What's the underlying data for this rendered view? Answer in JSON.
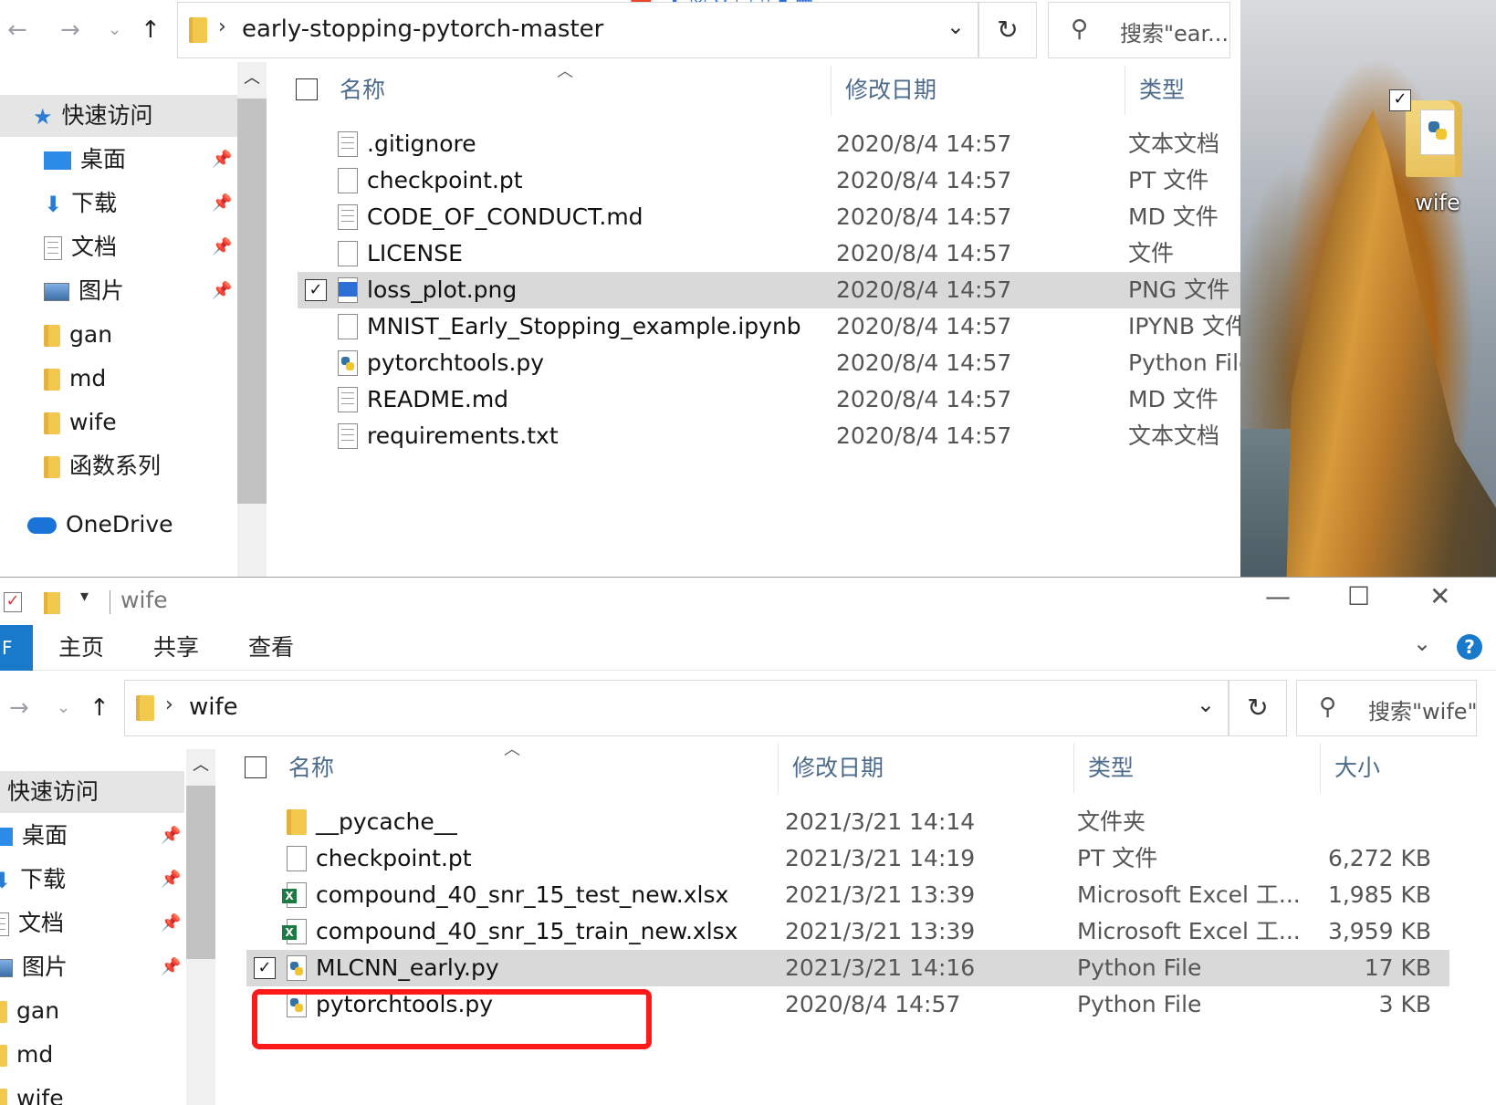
{
  "desktop": {
    "icon_label": "wife"
  },
  "window1": {
    "address_path": "early-stopping-pytorch-master",
    "search_placeholder": "搜索\"ear...",
    "nav": {
      "quick_access": "快速访问",
      "items": [
        "桌面",
        "下载",
        "文档",
        "图片",
        "gan",
        "md",
        "wife",
        "函数系列"
      ],
      "onedrive": "OneDrive"
    },
    "columns": {
      "name": "名称",
      "date": "修改日期",
      "type": "类型"
    },
    "files": [
      {
        "name": ".gitignore",
        "date": "2020/8/4 14:57",
        "type": "文本文档",
        "icon": "text-file-icon"
      },
      {
        "name": "checkpoint.pt",
        "date": "2020/8/4 14:57",
        "type": "PT 文件",
        "icon": "blank-file-icon"
      },
      {
        "name": "CODE_OF_CONDUCT.md",
        "date": "2020/8/4 14:57",
        "type": "MD 文件",
        "icon": "text-file-icon"
      },
      {
        "name": "LICENSE",
        "date": "2020/8/4 14:57",
        "type": "文件",
        "icon": "blank-file-icon"
      },
      {
        "name": "loss_plot.png",
        "date": "2020/8/4 14:57",
        "type": "PNG 文件",
        "icon": "image-file-icon",
        "selected": true
      },
      {
        "name": "MNIST_Early_Stopping_example.ipynb",
        "date": "2020/8/4 14:57",
        "type": "IPYNB 文件",
        "icon": "blank-file-icon"
      },
      {
        "name": "pytorchtools.py",
        "date": "2020/8/4 14:57",
        "type": "Python File",
        "icon": "python-file-icon"
      },
      {
        "name": "README.md",
        "date": "2020/8/4 14:57",
        "type": "MD 文件",
        "icon": "text-file-icon"
      },
      {
        "name": "requirements.txt",
        "date": "2020/8/4 14:57",
        "type": "文本文档",
        "icon": "text-file-icon"
      }
    ]
  },
  "window2": {
    "title": "wife",
    "ribbon_tabs": [
      "主页",
      "共享",
      "查看"
    ],
    "ribbon_file_tab": "F",
    "address_path": "wife",
    "search_placeholder": "搜索\"wife\"",
    "nav": {
      "quick_access": "快速访问",
      "items": [
        "桌面",
        "下载",
        "文档",
        "图片",
        "gan",
        "md",
        "wife"
      ]
    },
    "columns": {
      "name": "名称",
      "date": "修改日期",
      "type": "类型",
      "size": "大小"
    },
    "files": [
      {
        "name": "__pycache__",
        "date": "2021/3/21 14:14",
        "type": "文件夹",
        "size": "",
        "icon": "folder-icon"
      },
      {
        "name": "checkpoint.pt",
        "date": "2021/3/21 14:19",
        "type": "PT 文件",
        "size": "6,272 KB",
        "icon": "blank-file-icon"
      },
      {
        "name": "compound_40_snr_15_test_new.xlsx",
        "date": "2021/3/21 13:39",
        "type": "Microsoft Excel 工...",
        "size": "1,985 KB",
        "icon": "excel-file-icon"
      },
      {
        "name": "compound_40_snr_15_train_new.xlsx",
        "date": "2021/3/21 13:39",
        "type": "Microsoft Excel 工...",
        "size": "3,959 KB",
        "icon": "excel-file-icon"
      },
      {
        "name": "MLCNN_early.py",
        "date": "2021/3/21 14:16",
        "type": "Python File",
        "size": "17 KB",
        "icon": "python-file-icon",
        "selected": true
      },
      {
        "name": "pytorchtools.py",
        "date": "2020/8/4 14:57",
        "type": "Python File",
        "size": "3 KB",
        "icon": "python-file-icon"
      }
    ]
  },
  "colors": {
    "selection": "#d9d9d9",
    "accent": "#1979ca",
    "highlight": "#ff1a1a",
    "header_text": "#4d6b8a"
  }
}
